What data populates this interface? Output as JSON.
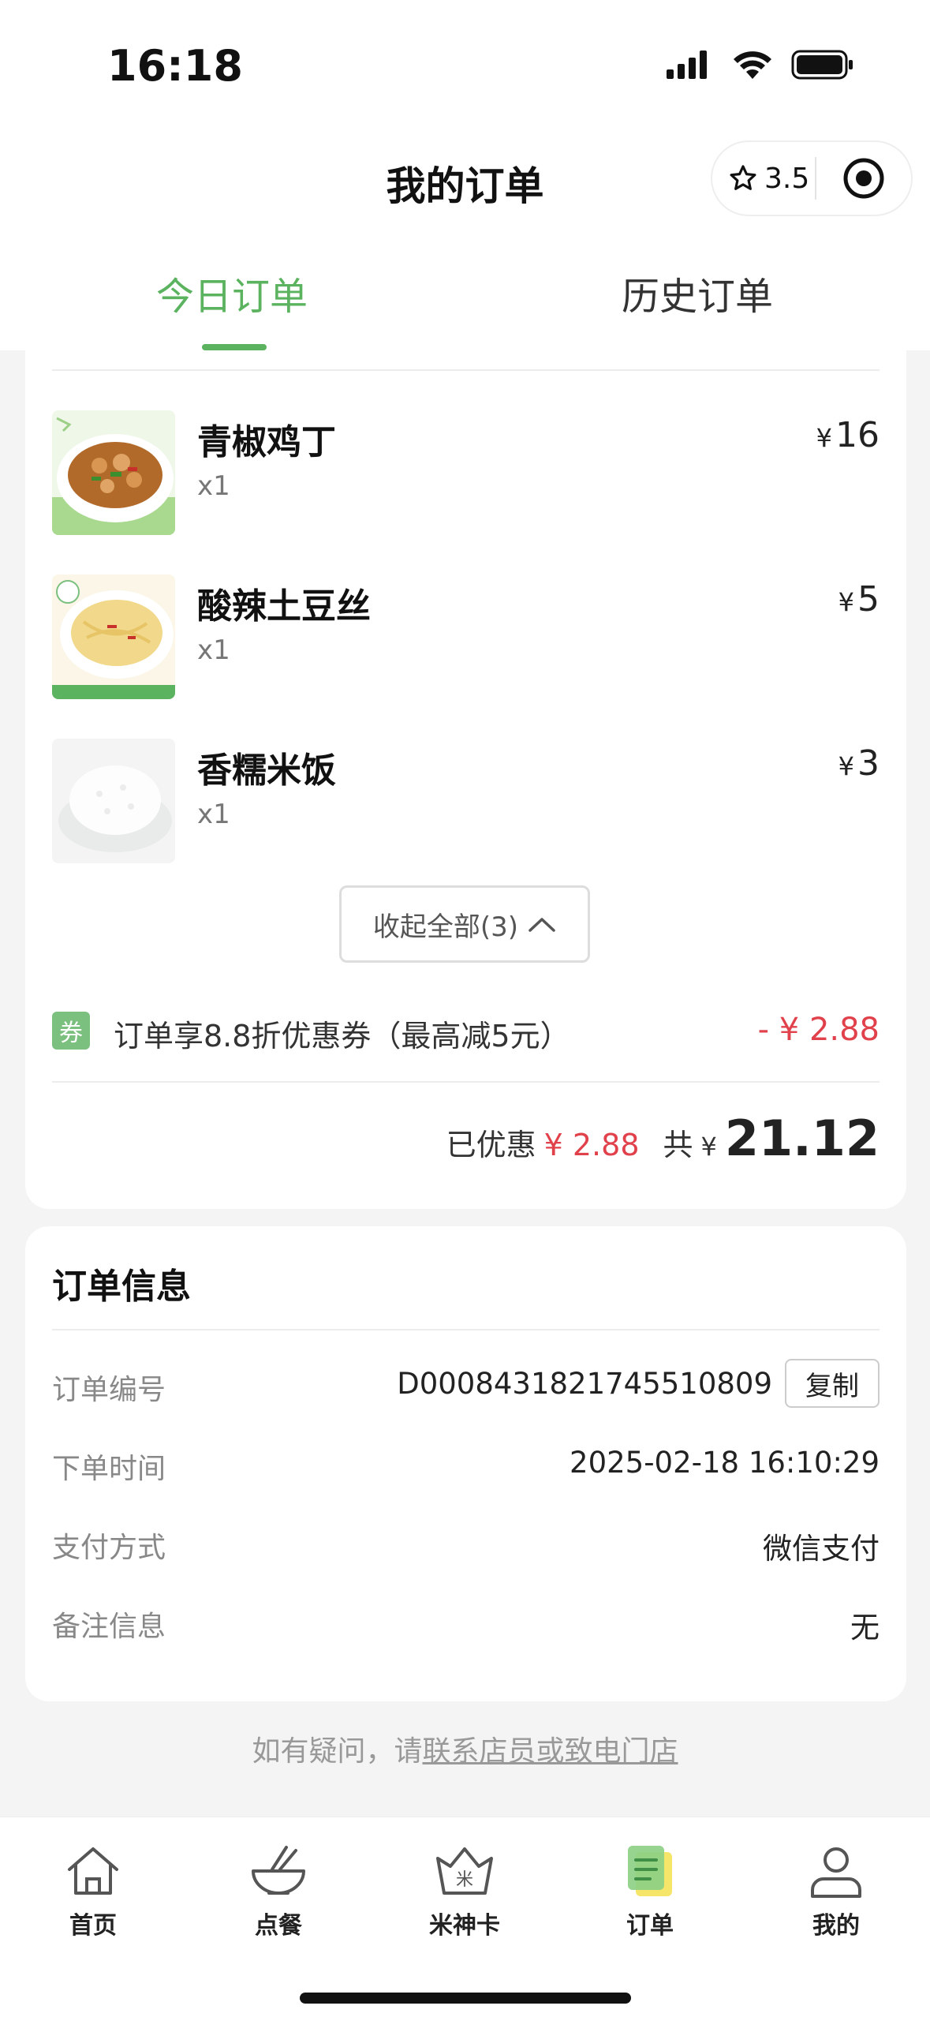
{
  "status_bar": {
    "time": "16:18"
  },
  "header": {
    "title": "我的订单",
    "rating": "3.5"
  },
  "tabs": [
    {
      "label": "今日订单",
      "active": true
    },
    {
      "label": "历史订单",
      "active": false
    }
  ],
  "items": [
    {
      "name": "青椒鸡丁",
      "qty": "x1",
      "currency": "¥",
      "price": "16"
    },
    {
      "name": "酸辣土豆丝",
      "qty": "x1",
      "currency": "¥",
      "price": "5"
    },
    {
      "name": "香糯米饭",
      "qty": "x1",
      "currency": "¥",
      "price": "3"
    }
  ],
  "collapse_label": "收起全部(3)",
  "coupon": {
    "badge": "券",
    "text": "订单享8.8折优惠券（最高减5元）",
    "amount": "- ¥ 2.88"
  },
  "summary": {
    "discount_label": "已优惠",
    "discount_value": "¥ 2.88",
    "total_label": "共",
    "total_currency": "¥",
    "total_value": "21.12"
  },
  "order_info": {
    "title": "订单信息",
    "rows": [
      {
        "label": "订单编号",
        "value": "D0008431821745510809"
      },
      {
        "label": "下单时间",
        "value": "2025-02-18 16:10:29"
      },
      {
        "label": "支付方式",
        "value": "微信支付"
      },
      {
        "label": "备注信息",
        "value": "无"
      }
    ],
    "copy_label": "复制"
  },
  "help": {
    "prefix": "如有疑问，请",
    "link": "联系店员或致电门店"
  },
  "tabbar": [
    {
      "label": "首页",
      "icon": "home-icon"
    },
    {
      "label": "点餐",
      "icon": "bowl-icon"
    },
    {
      "label": "米神卡",
      "icon": "crown-card-icon"
    },
    {
      "label": "订单",
      "icon": "order-icon",
      "active": true
    },
    {
      "label": "我的",
      "icon": "profile-icon"
    }
  ],
  "colors": {
    "accent": "#5bb35f",
    "discount": "#e0414b"
  }
}
